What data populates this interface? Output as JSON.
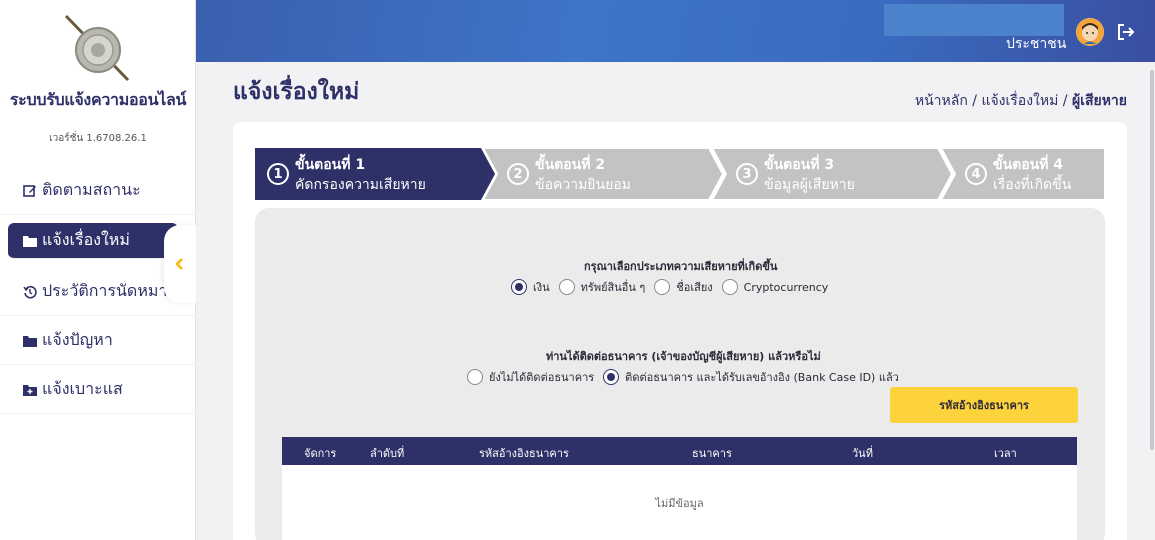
{
  "sidebar": {
    "app_title": "ระบบรับแจ้งความออนไลน์",
    "version": "เวอร์ชั่น 1.6708.26.1",
    "items": [
      {
        "label": "ติดตามสถานะ",
        "icon": "edit-icon"
      },
      {
        "label": "แจ้งเรื่องใหม่",
        "icon": "folder-icon",
        "active": true
      },
      {
        "label": "ประวัติการนัดหมาย",
        "icon": "history-icon"
      },
      {
        "label": "แจ้งปัญหา",
        "icon": "folder-icon"
      },
      {
        "label": "แจ้งเบาะแส",
        "icon": "folder-plus-icon"
      }
    ]
  },
  "header": {
    "user_name": "ประชาชน"
  },
  "page": {
    "title": "แจ้งเรื่องใหม่",
    "breadcrumb": {
      "home": "หน้าหลัก",
      "parent": "แจ้งเรื่องใหม่",
      "current": "ผู้เสียหาย",
      "separator": "/"
    }
  },
  "steps": [
    {
      "number": "1",
      "title": "ขั้นตอนที่ 1",
      "subtitle": "คัดกรองความเสียหาย",
      "active": true
    },
    {
      "number": "2",
      "title": "ขั้นตอนที่ 2",
      "subtitle": "ข้อความยินยอม",
      "active": false
    },
    {
      "number": "3",
      "title": "ขั้นตอนที่ 3",
      "subtitle": "ข้อมูลผู้เสียหาย",
      "active": false
    },
    {
      "number": "4",
      "title": "ขั้นตอนที่ 4",
      "subtitle": "เรื่องที่เกิดขึ้น",
      "active": false
    }
  ],
  "damage_question": {
    "label": "กรุณาเลือกประเภทความเสียหายที่เกิดขึ้น",
    "options": [
      {
        "label": "เงิน",
        "selected": true
      },
      {
        "label": "ทรัพย์สินอื่น ๆ",
        "selected": false
      },
      {
        "label": "ชื่อเสียง",
        "selected": false
      },
      {
        "label": "Cryptocurrency",
        "selected": false
      }
    ]
  },
  "bank_question": {
    "label": "ท่านได้ติดต่อธนาคาร (เจ้าของบัญชีผู้เสียหาย) แล้วหรือไม่",
    "options": [
      {
        "label": "ยังไม่ได้ติดต่อธนาคาร",
        "selected": false
      },
      {
        "label": "ติดต่อธนาคาร และได้รับเลขอ้างอิง (Bank Case ID) แล้ว",
        "selected": true
      }
    ]
  },
  "bank_ref_button": "รหัสอ้างอิงธนาคาร",
  "table": {
    "columns": [
      "จัดการ",
      "ลำดับที่",
      "รหัสอ้างอิงธนาคาร",
      "ธนาคาร",
      "วันที่",
      "เวลา"
    ],
    "empty_text": "ไม่มีข้อมูล"
  },
  "colors": {
    "primary": "#2e3068",
    "accent": "#fdd33c",
    "step_inactive": "#c3c3c3",
    "header_blue": "#3f74c7"
  }
}
